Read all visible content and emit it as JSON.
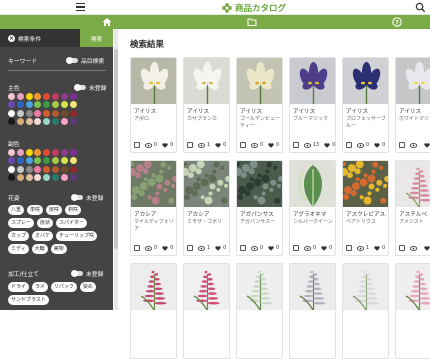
{
  "app": {
    "title": "商品カタログ"
  },
  "sidebar": {
    "tab_conditions": "検索条件",
    "tab_search": "検索",
    "keyword_label": "キーワード",
    "item_number_toggle": "品目検索",
    "main_color_label": "主色",
    "sub_color_label": "副色",
    "unregistered": "未登録",
    "flower_type_label": "花姿",
    "processing_label": "加工/仕立て",
    "flower_chips": [
      "八重",
      "単咲",
      "房咲",
      "剣咲",
      "スプレー",
      "房状",
      "スパイダー",
      "カップ",
      "オバケ",
      "チューリップ咲",
      "ミディ",
      "大輪",
      "実物"
    ],
    "process_chips": [
      "ドライ",
      "ラメ",
      "リパック",
      "染め",
      "サンドブラスト"
    ],
    "swatch_colors": [
      "#f4c6d6",
      "#e8a2c0",
      "#f5d900",
      "#f09a2f",
      "#e24a33",
      "#c23a5d",
      "#8b3a8f",
      "#7d2e9c",
      "#6a4bb1",
      "#2f66c2",
      "#4aa3df",
      "#7bc44f",
      "#3a9b3e",
      "#a8ca47",
      "#d6e34a",
      "#f4e57a",
      "#ffffff",
      "#c9c9c9",
      "#8b8b8b",
      "#ef7fa1",
      "#d65e2c",
      "#b05a2a",
      "#6e4b2a",
      "#8c2a2a",
      "#1a1a1a",
      "#d9b073",
      "#e1c2a0",
      "#f2d9d6",
      "#9ad3c8",
      "#2d7a6e",
      "#ff9fbf",
      "#5b3a7a"
    ]
  },
  "main": {
    "title": "検索結果",
    "cards": [
      {
        "name": "アイリス",
        "variety": "アポロ",
        "views": "0",
        "likes": "0"
      },
      {
        "name": "アイリス",
        "variety": "カサブランカ",
        "views": "1",
        "likes": "0"
      },
      {
        "name": "アイリス",
        "variety": "ゴールデンビューティー",
        "views": "0",
        "likes": "0"
      },
      {
        "name": "アイリス",
        "variety": "ブルーマジック",
        "views": "13",
        "likes": "0"
      },
      {
        "name": "アイリス",
        "variety": "プロフェッサーブルー",
        "views": "0",
        "likes": "0"
      },
      {
        "name": "アイリス",
        "variety": "ホワイトマジック",
        "views": "",
        "likes": ""
      },
      {
        "name": "アカシア",
        "variety": "マイルディフォリア",
        "views": "0",
        "likes": "0"
      },
      {
        "name": "アカシア",
        "variety": "ミモザ・ゴボリ",
        "views": "1",
        "likes": "0"
      },
      {
        "name": "アガパンサス",
        "variety": "アガパンサスー",
        "views": "0",
        "likes": "0"
      },
      {
        "name": "アグラオネマ",
        "variety": "シルバークイーン",
        "views": "0",
        "likes": "0"
      },
      {
        "name": "アスクレピアス",
        "variety": "ベアトリクス",
        "views": "1",
        "likes": "0"
      },
      {
        "name": "アスチルベ",
        "variety": "アメジスト",
        "views": "",
        "likes": ""
      }
    ]
  }
}
